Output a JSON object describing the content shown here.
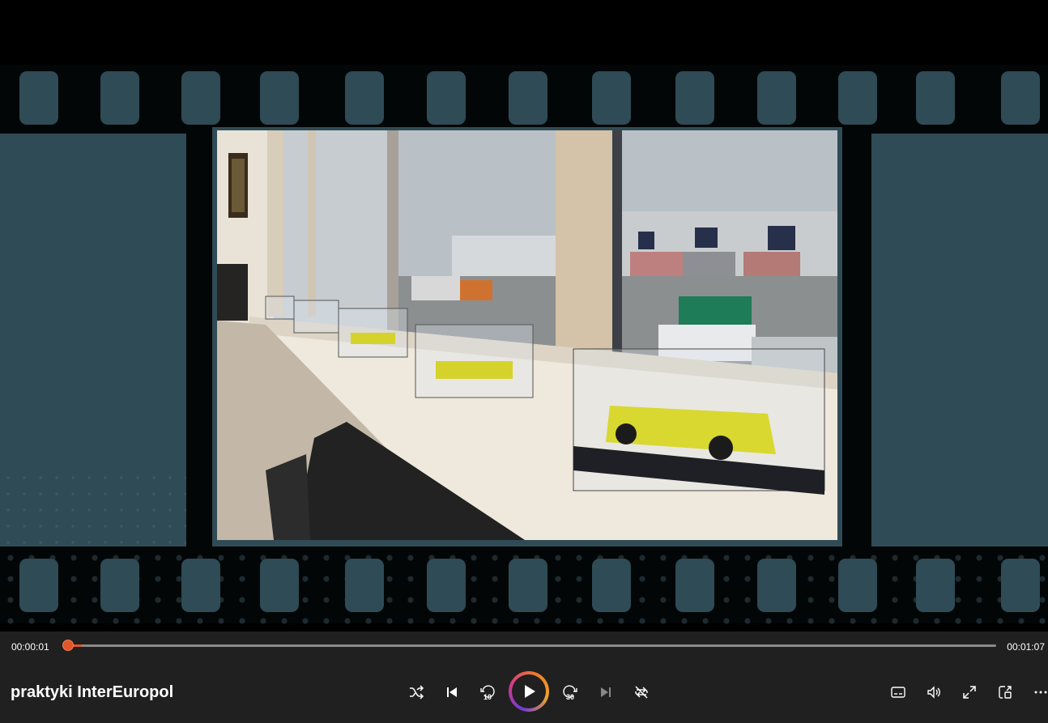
{
  "player": {
    "title": "praktyki InterEuropol",
    "current_time": "00:00:01",
    "duration": "00:01:07",
    "progress": 0.015
  },
  "controls": {
    "shuffle_icon": "shuffle-icon",
    "previous_icon": "previous-icon",
    "rewind_icon": "rewind-10-icon",
    "rewind_label": "10",
    "play_icon": "play-icon",
    "forward_icon": "forward-30-icon",
    "forward_label": "30",
    "next_icon": "next-icon",
    "repeat_icon": "repeat-icon",
    "captions_icon": "captions-icon",
    "volume_icon": "volume-icon",
    "fullscreen_icon": "fullscreen-icon",
    "miniplayer_icon": "miniplayer-icon",
    "more_icon": "more-icon"
  },
  "colors": {
    "accent": "#e2562b",
    "film_teal": "#2f4b55",
    "control_bar": "#202020"
  }
}
